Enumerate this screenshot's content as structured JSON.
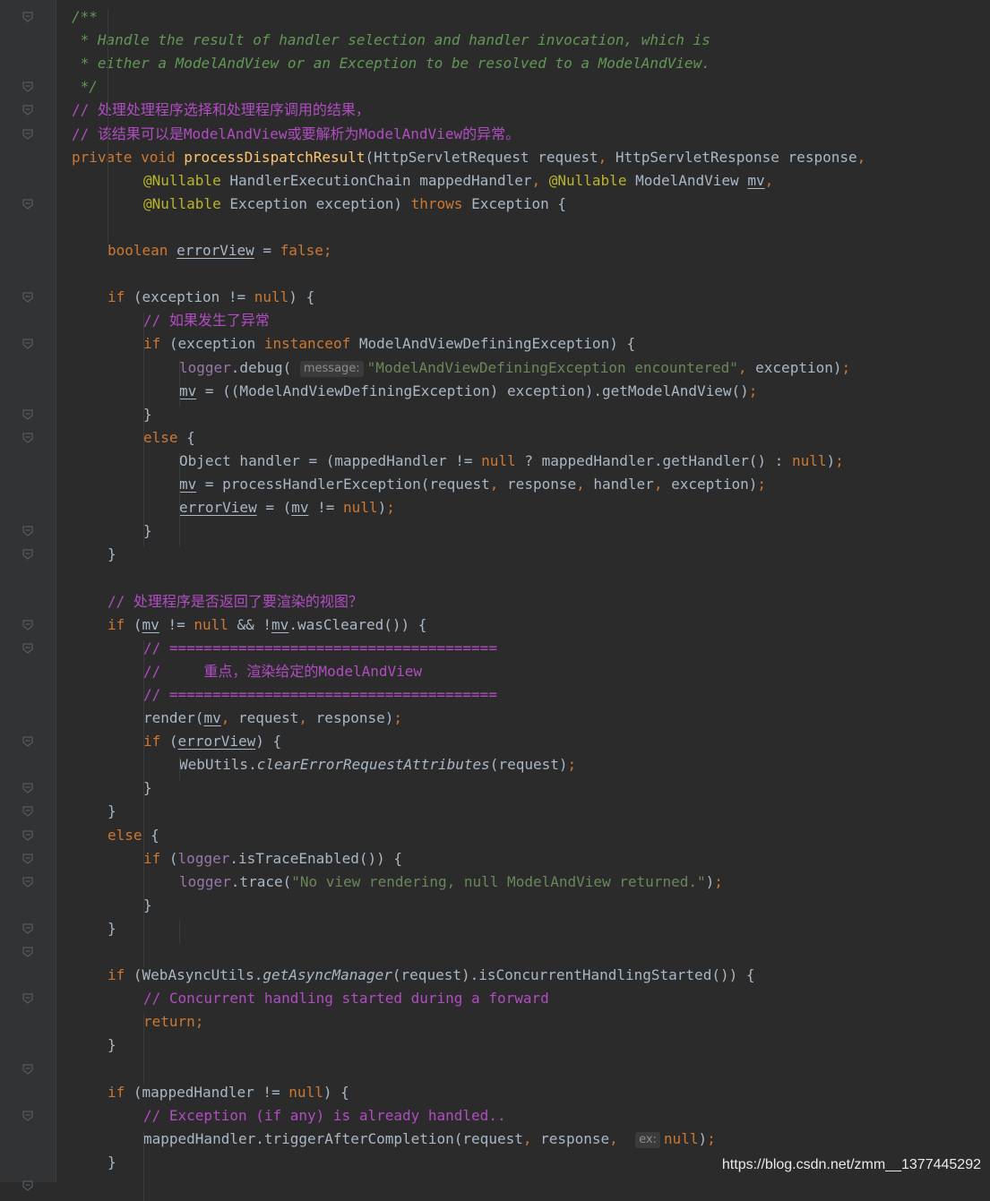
{
  "editor": {
    "watermark": "https://blog.csdn.net/zmm__1377445292",
    "code_lines": [
      {
        "indent": 0,
        "segs": [
          {
            "t": "/**",
            "c": "doc"
          }
        ]
      },
      {
        "indent": 0,
        "segs": [
          {
            "t": " * Handle the result of handler selection and handler invocation, which is",
            "c": "doc"
          }
        ]
      },
      {
        "indent": 0,
        "segs": [
          {
            "t": " * either a ModelAndView or an Exception to be resolved to a ModelAndView.",
            "c": "doc"
          }
        ]
      },
      {
        "indent": 0,
        "segs": [
          {
            "t": " */",
            "c": "doc"
          }
        ]
      },
      {
        "indent": 0,
        "segs": [
          {
            "t": "// 处理处理程序选择和处理程序调用的结果，",
            "c": "cmt"
          }
        ]
      },
      {
        "indent": 0,
        "segs": [
          {
            "t": "// 该结果可以是ModelAndView或要解析为ModelAndView的异常。",
            "c": "cmt"
          }
        ]
      },
      {
        "indent": 0,
        "segs": [
          {
            "t": "private void ",
            "c": "kw"
          },
          {
            "t": "processDispatchResult",
            "c": "fn"
          },
          {
            "t": "(HttpServletRequest request",
            "c": ""
          },
          {
            "t": ", ",
            "c": "kw"
          },
          {
            "t": "HttpServletResponse response",
            "c": ""
          },
          {
            "t": ",",
            "c": "kw"
          }
        ]
      },
      {
        "indent": 2,
        "segs": [
          {
            "t": "@Nullable ",
            "c": "ann"
          },
          {
            "t": "HandlerExecutionChain mappedHandler",
            "c": ""
          },
          {
            "t": ", ",
            "c": "kw"
          },
          {
            "t": "@Nullable ",
            "c": "ann"
          },
          {
            "t": "ModelAndView ",
            "c": ""
          },
          {
            "t": "mv",
            "c": "ul"
          },
          {
            "t": ",",
            "c": "kw"
          }
        ]
      },
      {
        "indent": 2,
        "segs": [
          {
            "t": "@Nullable ",
            "c": "ann"
          },
          {
            "t": "Exception exception) ",
            "c": ""
          },
          {
            "t": "throws ",
            "c": "kw"
          },
          {
            "t": "Exception {",
            "c": ""
          }
        ]
      },
      {
        "indent": 0,
        "segs": []
      },
      {
        "indent": 1,
        "segs": [
          {
            "t": "boolean ",
            "c": "kw"
          },
          {
            "t": "errorView",
            "c": "ul"
          },
          {
            "t": " = ",
            "c": ""
          },
          {
            "t": "false;",
            "c": "kw"
          }
        ]
      },
      {
        "indent": 0,
        "segs": []
      },
      {
        "indent": 1,
        "segs": [
          {
            "t": "if ",
            "c": "kw"
          },
          {
            "t": "(exception != ",
            "c": ""
          },
          {
            "t": "null",
            "c": "kw"
          },
          {
            "t": ") {",
            "c": ""
          }
        ]
      },
      {
        "indent": 2,
        "segs": [
          {
            "t": "// 如果发生了异常",
            "c": "cmt"
          }
        ]
      },
      {
        "indent": 2,
        "segs": [
          {
            "t": "if ",
            "c": "kw"
          },
          {
            "t": "(exception ",
            "c": ""
          },
          {
            "t": "instanceof ",
            "c": "kw"
          },
          {
            "t": "ModelAndViewDefiningException) {",
            "c": ""
          }
        ]
      },
      {
        "indent": 3,
        "segs": [
          {
            "t": "logger",
            "c": "field"
          },
          {
            "t": ".debug( ",
            "c": ""
          },
          {
            "t": "message:",
            "c": "hint"
          },
          {
            "t": "\"ModelAndViewDefiningException encountered\"",
            "c": "str"
          },
          {
            "t": ", ",
            "c": "kw"
          },
          {
            "t": "exception)",
            "c": ""
          },
          {
            "t": ";",
            "c": "kw"
          }
        ]
      },
      {
        "indent": 3,
        "segs": [
          {
            "t": "mv",
            "c": "ul"
          },
          {
            "t": " = ((ModelAndViewDefiningException) exception).getModelAndView()",
            "c": ""
          },
          {
            "t": ";",
            "c": "kw"
          }
        ]
      },
      {
        "indent": 2,
        "segs": [
          {
            "t": "}",
            "c": ""
          }
        ]
      },
      {
        "indent": 2,
        "segs": [
          {
            "t": "else ",
            "c": "kw"
          },
          {
            "t": "{",
            "c": ""
          }
        ]
      },
      {
        "indent": 3,
        "segs": [
          {
            "t": "Object handler = (mappedHandler != ",
            "c": ""
          },
          {
            "t": "null ",
            "c": "kw"
          },
          {
            "t": "? mappedHandler.getHandler() : ",
            "c": ""
          },
          {
            "t": "null",
            "c": "kw"
          },
          {
            "t": ")",
            "c": ""
          },
          {
            "t": ";",
            "c": "kw"
          }
        ]
      },
      {
        "indent": 3,
        "segs": [
          {
            "t": "mv",
            "c": "ul"
          },
          {
            "t": " = processHandlerException(request",
            "c": ""
          },
          {
            "t": ", ",
            "c": "kw"
          },
          {
            "t": "response",
            "c": ""
          },
          {
            "t": ", ",
            "c": "kw"
          },
          {
            "t": "handler",
            "c": ""
          },
          {
            "t": ", ",
            "c": "kw"
          },
          {
            "t": "exception)",
            "c": ""
          },
          {
            "t": ";",
            "c": "kw"
          }
        ]
      },
      {
        "indent": 3,
        "segs": [
          {
            "t": "errorView",
            "c": "ul"
          },
          {
            "t": " = (",
            "c": ""
          },
          {
            "t": "mv",
            "c": "ul"
          },
          {
            "t": " != ",
            "c": ""
          },
          {
            "t": "null",
            "c": "kw"
          },
          {
            "t": ")",
            "c": ""
          },
          {
            "t": ";",
            "c": "kw"
          }
        ]
      },
      {
        "indent": 2,
        "segs": [
          {
            "t": "}",
            "c": ""
          }
        ]
      },
      {
        "indent": 1,
        "segs": [
          {
            "t": "}",
            "c": ""
          }
        ]
      },
      {
        "indent": 0,
        "segs": []
      },
      {
        "indent": 1,
        "segs": [
          {
            "t": "// 处理程序是否返回了要渲染的视图？",
            "c": "cmt"
          }
        ]
      },
      {
        "indent": 1,
        "segs": [
          {
            "t": "if ",
            "c": "kw"
          },
          {
            "t": "(",
            "c": ""
          },
          {
            "t": "mv",
            "c": "ul"
          },
          {
            "t": " != ",
            "c": ""
          },
          {
            "t": "null ",
            "c": "kw"
          },
          {
            "t": "&& !",
            "c": ""
          },
          {
            "t": "mv",
            "c": "ul"
          },
          {
            "t": ".wasCleared()) {",
            "c": ""
          }
        ]
      },
      {
        "indent": 2,
        "segs": [
          {
            "t": "// ======================================",
            "c": "cmt"
          }
        ]
      },
      {
        "indent": 2,
        "segs": [
          {
            "t": "//     重点，渲染给定的ModelAndView",
            "c": "cmt"
          }
        ]
      },
      {
        "indent": 2,
        "segs": [
          {
            "t": "// ======================================",
            "c": "cmt"
          }
        ]
      },
      {
        "indent": 2,
        "segs": [
          {
            "t": "render(",
            "c": ""
          },
          {
            "t": "mv",
            "c": "ul"
          },
          {
            "t": ", ",
            "c": "kw"
          },
          {
            "t": "request",
            "c": ""
          },
          {
            "t": ", ",
            "c": "kw"
          },
          {
            "t": "response)",
            "c": ""
          },
          {
            "t": ";",
            "c": "kw"
          }
        ]
      },
      {
        "indent": 2,
        "segs": [
          {
            "t": "if ",
            "c": "kw"
          },
          {
            "t": "(",
            "c": ""
          },
          {
            "t": "errorView",
            "c": "ul"
          },
          {
            "t": ") {",
            "c": ""
          }
        ]
      },
      {
        "indent": 3,
        "segs": [
          {
            "t": "WebUtils.",
            "c": ""
          },
          {
            "t": "clearErrorRequestAttributes",
            "c": "ital"
          },
          {
            "t": "(request)",
            "c": ""
          },
          {
            "t": ";",
            "c": "kw"
          }
        ]
      },
      {
        "indent": 2,
        "segs": [
          {
            "t": "}",
            "c": ""
          }
        ]
      },
      {
        "indent": 1,
        "segs": [
          {
            "t": "}",
            "c": ""
          }
        ]
      },
      {
        "indent": 1,
        "segs": [
          {
            "t": "else ",
            "c": "kw"
          },
          {
            "t": "{",
            "c": ""
          }
        ]
      },
      {
        "indent": 2,
        "segs": [
          {
            "t": "if ",
            "c": "kw"
          },
          {
            "t": "(",
            "c": ""
          },
          {
            "t": "logger",
            "c": "field"
          },
          {
            "t": ".isTraceEnabled()) {",
            "c": ""
          }
        ]
      },
      {
        "indent": 3,
        "segs": [
          {
            "t": "logger",
            "c": "field"
          },
          {
            "t": ".trace(",
            "c": ""
          },
          {
            "t": "\"No view rendering, null ModelAndView returned.\"",
            "c": "str"
          },
          {
            "t": ")",
            "c": ""
          },
          {
            "t": ";",
            "c": "kw"
          }
        ]
      },
      {
        "indent": 2,
        "segs": [
          {
            "t": "}",
            "c": ""
          }
        ]
      },
      {
        "indent": 1,
        "segs": [
          {
            "t": "}",
            "c": ""
          }
        ]
      },
      {
        "indent": 0,
        "segs": []
      },
      {
        "indent": 1,
        "segs": [
          {
            "t": "if ",
            "c": "kw"
          },
          {
            "t": "(WebAsyncUtils.",
            "c": ""
          },
          {
            "t": "getAsyncManager",
            "c": "ital"
          },
          {
            "t": "(request).isConcurrentHandlingStarted()) {",
            "c": ""
          }
        ]
      },
      {
        "indent": 2,
        "segs": [
          {
            "t": "// Concurrent handling started during a forward",
            "c": "cmt"
          }
        ]
      },
      {
        "indent": 2,
        "segs": [
          {
            "t": "return;",
            "c": "kw"
          }
        ]
      },
      {
        "indent": 1,
        "segs": [
          {
            "t": "}",
            "c": ""
          }
        ]
      },
      {
        "indent": 0,
        "segs": []
      },
      {
        "indent": 1,
        "segs": [
          {
            "t": "if ",
            "c": "kw"
          },
          {
            "t": "(mappedHandler != ",
            "c": ""
          },
          {
            "t": "null",
            "c": "kw"
          },
          {
            "t": ") {",
            "c": ""
          }
        ]
      },
      {
        "indent": 2,
        "segs": [
          {
            "t": "// Exception (if any) is already handled..",
            "c": "cmt"
          }
        ]
      },
      {
        "indent": 2,
        "segs": [
          {
            "t": "mappedHandler.triggerAfterCompletion(request",
            "c": ""
          },
          {
            "t": ", ",
            "c": "kw"
          },
          {
            "t": "response",
            "c": ""
          },
          {
            "t": ", ",
            "c": "kw"
          },
          {
            "t": " ",
            "c": ""
          },
          {
            "t": "ex:",
            "c": "hint"
          },
          {
            "t": "null",
            "c": "kw"
          },
          {
            "t": ")",
            "c": ""
          },
          {
            "t": ";",
            "c": "kw"
          }
        ]
      },
      {
        "indent": 1,
        "segs": [
          {
            "t": "}",
            "c": ""
          }
        ]
      }
    ]
  }
}
